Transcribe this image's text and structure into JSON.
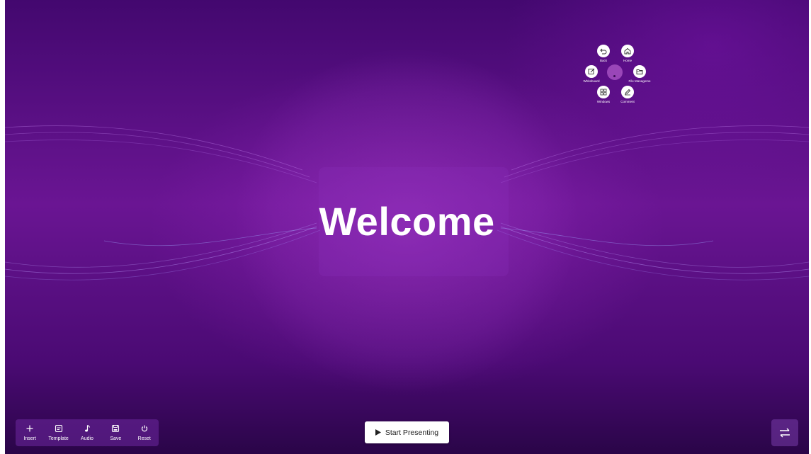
{
  "slide": {
    "title": "Welcome"
  },
  "radial_menu": {
    "items": [
      {
        "label": "Back",
        "icon": "back-arrow-icon"
      },
      {
        "label": "Home",
        "icon": "home-icon"
      },
      {
        "label": "Whiteboard",
        "icon": "whiteboard-icon"
      },
      {
        "label": "File Manageme",
        "icon": "folder-icon"
      },
      {
        "label": "Windows",
        "icon": "windows-grid-icon"
      },
      {
        "label": "Comment",
        "icon": "pen-icon"
      }
    ]
  },
  "toolbar": {
    "items": [
      {
        "label": "Insert",
        "icon": "plus-icon"
      },
      {
        "label": "Template",
        "icon": "template-icon"
      },
      {
        "label": "Audio",
        "icon": "music-note-icon"
      },
      {
        "label": "Save",
        "icon": "save-icon"
      },
      {
        "label": "Reset",
        "icon": "power-icon"
      }
    ]
  },
  "start_button": {
    "label": "Start Presenting",
    "icon": "play-icon"
  },
  "switch_button": {
    "icon": "swap-arrows-icon"
  },
  "colors": {
    "background": "#5a1088",
    "accent": "#ffffff"
  }
}
